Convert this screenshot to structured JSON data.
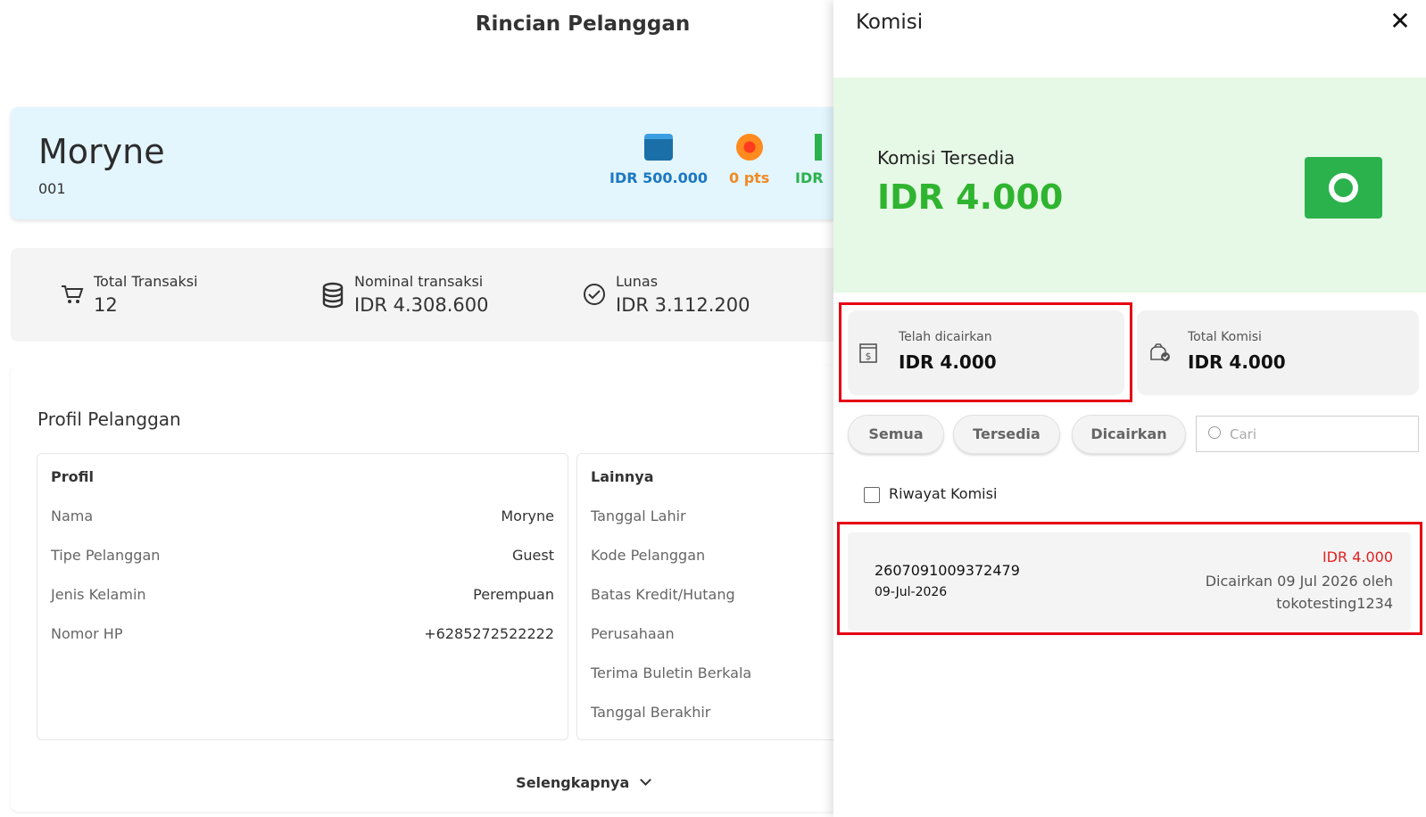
{
  "page": {
    "title": "Rincian Pelanggan",
    "customer": {
      "name": "Moryne",
      "code": "001",
      "deposit": "IDR 500.000",
      "points": "0 pts",
      "third_chip": "IDR"
    },
    "stats": [
      {
        "icon": "cart-icon",
        "label": "Total Transaksi",
        "value": "12"
      },
      {
        "icon": "coins-icon",
        "label": "Nominal transaksi",
        "value": "IDR 4.308.600"
      },
      {
        "icon": "check-circle-icon",
        "label": "Lunas",
        "value": "IDR 3.112.200"
      }
    ],
    "profile": {
      "title": "Profil Pelanggan",
      "profile_card": {
        "heading": "Profil",
        "rows": [
          {
            "key": "Nama",
            "value": "Moryne"
          },
          {
            "key": "Tipe Pelanggan",
            "value": "Guest"
          },
          {
            "key": "Jenis Kelamin",
            "value": "Perempuan"
          },
          {
            "key": "Nomor HP",
            "value": "+6285272522222"
          }
        ]
      },
      "other_card": {
        "heading": "Lainnya",
        "rows": [
          "Tanggal Lahir",
          "Kode Pelanggan",
          "Batas Kredit/Hutang",
          "Perusahaan",
          "Terima Buletin Berkala",
          "Tanggal Berakhir"
        ]
      },
      "more_label": "Selengkapnya"
    }
  },
  "drawer": {
    "title": "Komisi",
    "close_symbol": "✕",
    "available": {
      "label": "Komisi Tersedia",
      "value": "IDR 4.000",
      "color": "#2fb42f"
    },
    "cards": [
      {
        "icon": "receipt-dollar-icon",
        "label": "Telah dicairkan",
        "value": "IDR 4.000"
      },
      {
        "icon": "money-bag-check-icon",
        "label": "Total Komisi",
        "value": "IDR 4.000"
      }
    ],
    "filters": [
      "Semua",
      "Tersedia",
      "Dicairkan"
    ],
    "search": {
      "placeholder": "Cari",
      "value": ""
    },
    "history_label": "Riwayat Komisi",
    "items": [
      {
        "id": "2607091009372479",
        "date": "09-Jul-2026",
        "amount": "IDR 4.000",
        "note": "Dicairkan 09 Jul 2026 oleh tokotesting1234"
      }
    ],
    "highlight_color": "#e60012"
  }
}
